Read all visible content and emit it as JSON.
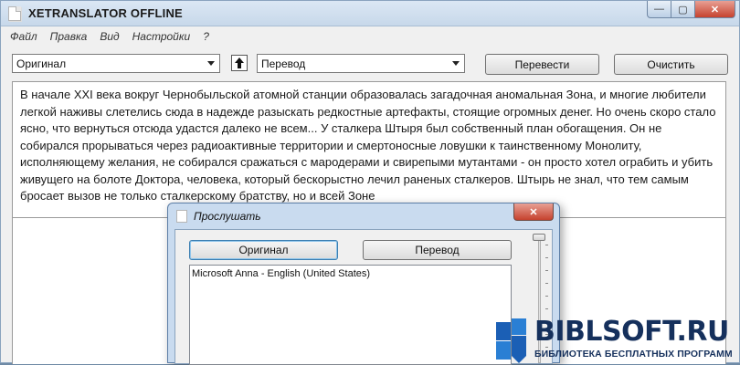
{
  "window": {
    "title": "XETRANSLATOR OFFLINE",
    "min_glyph": "—",
    "max_glyph": "▢",
    "close_glyph": "✕"
  },
  "menu": [
    "Файл",
    "Правка",
    "Вид",
    "Настройки",
    "?"
  ],
  "toolbar": {
    "source_language": "Оригинал",
    "target_language": "Перевод",
    "translate_label": "Перевести",
    "clear_label": "Очистить",
    "swap_icon": "swap-arrow-icon"
  },
  "source_text": "В начале XXI века вокруг Чернобыльской атомной станции образовалась загадочная аномальная Зона, и многие любители легкой наживы слетелись сюда в надежде разыскать редкостные артефакты, стоящие огромных денег. Но очень скоро стало ясно, что вернуться отсюда удастся далеко не всем... У сталкера Штыря был собственный план обогащения. Он не собирался прорываться через радиоактивные территории и смертоносные ловушки к таинственному Монолиту, исполняющему желания, не собирался сражаться с мародерами и свирепыми мутантами - он просто хотел ограбить и убить живущего на болоте Доктора, человека, который бескорыстно лечил раненых сталкеров. Штырь не знал, что тем самым бросает вызов не только сталкерскому братству, но и всей Зоне",
  "dialog": {
    "title": "Прослушать",
    "close_glyph": "✕",
    "original_label": "Оригинал",
    "translation_label": "Перевод",
    "voices": [
      "Microsoft Anna - English (United States)"
    ]
  },
  "watermark": {
    "title": "BIBLSOFT.RU",
    "subtitle": "БИБЛИОТЕКА БЕСПЛАТНЫХ ПРОГРАММ"
  },
  "colors": {
    "titlebar": "#c7d8ea",
    "close_button": "#c6422e",
    "watermark_text": "#15305c"
  }
}
